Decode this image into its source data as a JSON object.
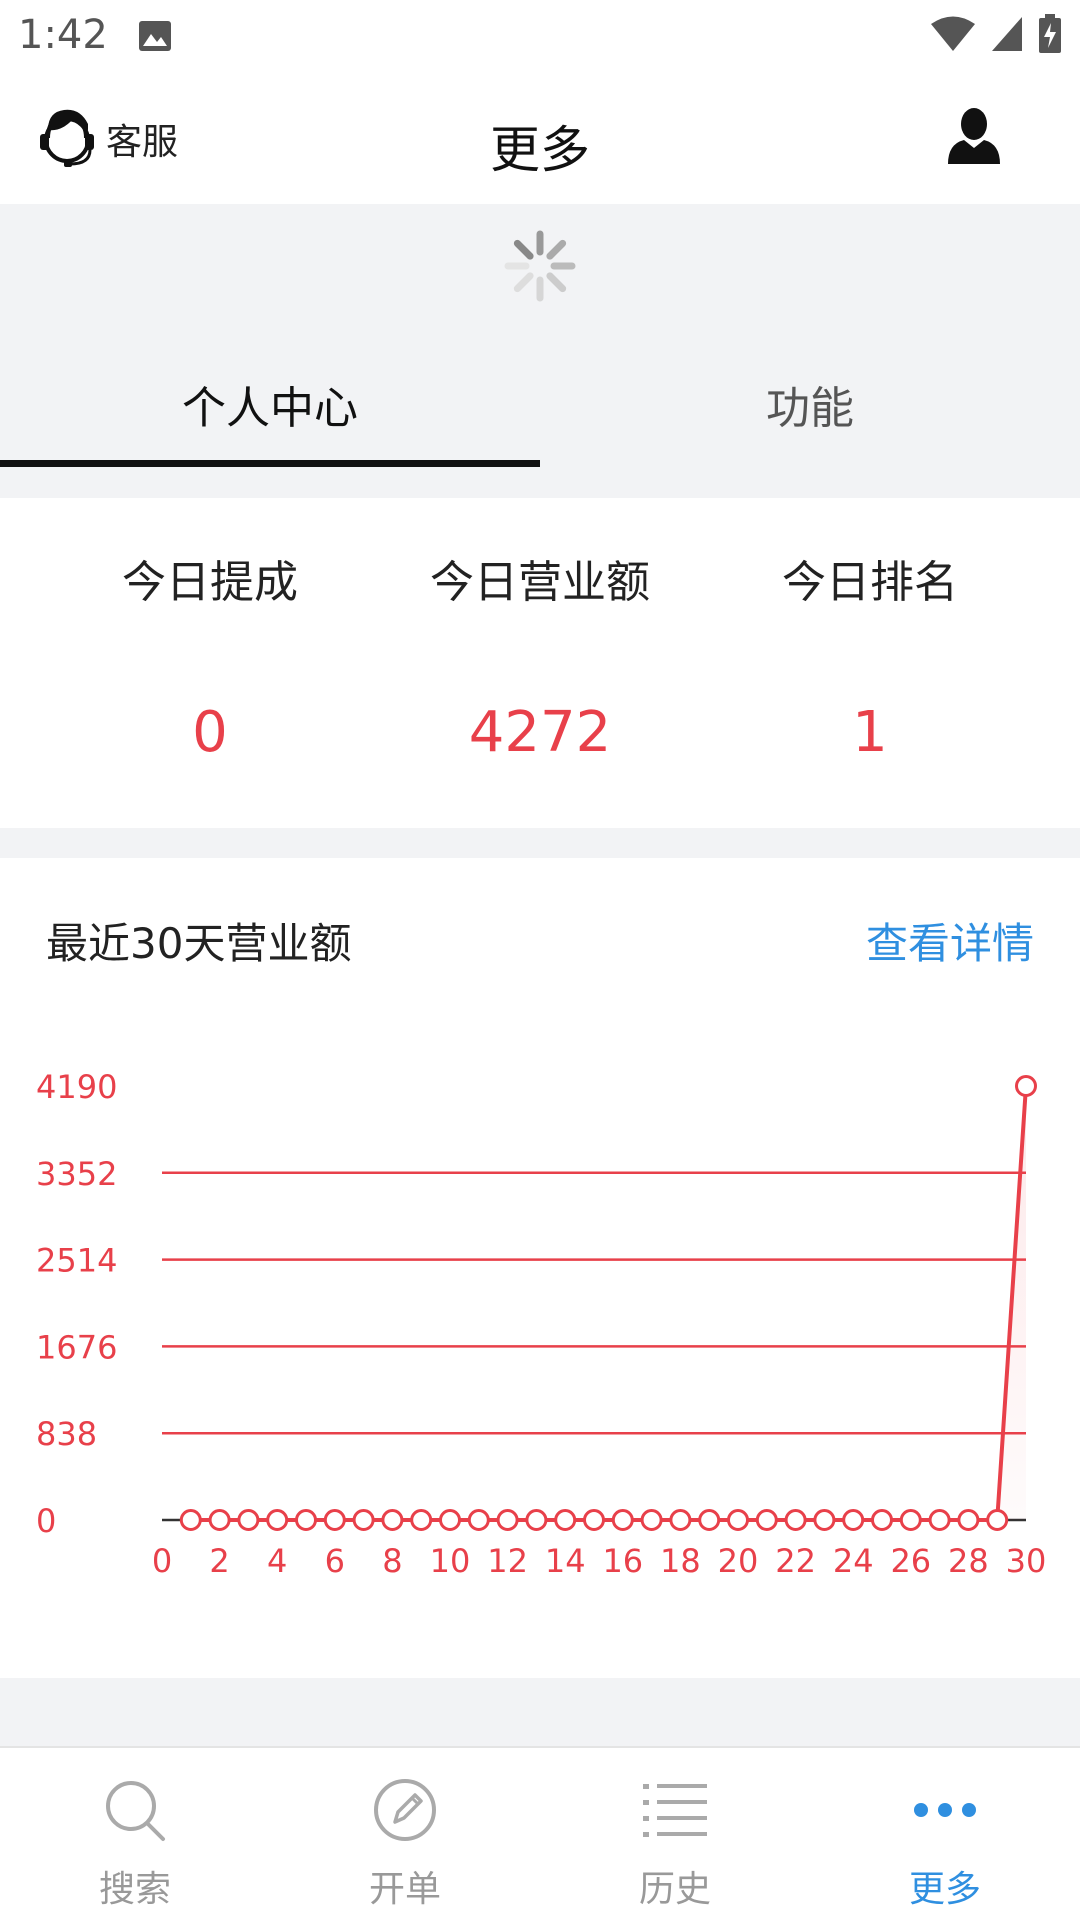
{
  "status_bar": {
    "time": "1:42"
  },
  "header": {
    "customer_service_label": "客服",
    "title": "更多"
  },
  "tabs": [
    {
      "label": "个人中心",
      "active": true
    },
    {
      "label": "功能",
      "active": false
    }
  ],
  "stats": [
    {
      "label": "今日提成",
      "value": "0"
    },
    {
      "label": "今日营业额",
      "value": "4272"
    },
    {
      "label": "今日排名",
      "value": "1"
    }
  ],
  "chart_section": {
    "title": "最近30天营业额",
    "link": "查看详情"
  },
  "chart_data": {
    "type": "line",
    "x": [
      1,
      2,
      3,
      4,
      5,
      6,
      7,
      8,
      9,
      10,
      11,
      12,
      13,
      14,
      15,
      16,
      17,
      18,
      19,
      20,
      21,
      22,
      23,
      24,
      25,
      26,
      27,
      28,
      29,
      30
    ],
    "values": [
      0,
      0,
      0,
      0,
      0,
      0,
      0,
      0,
      0,
      0,
      0,
      0,
      0,
      0,
      0,
      0,
      0,
      0,
      0,
      0,
      0,
      0,
      0,
      0,
      0,
      0,
      0,
      0,
      0,
      4190
    ],
    "xlim": [
      0,
      30
    ],
    "ylim": [
      0,
      4190
    ],
    "x_ticks": [
      "0",
      "2",
      "4",
      "6",
      "8",
      "10",
      "12",
      "14",
      "16",
      "18",
      "20",
      "22",
      "24",
      "26",
      "28",
      "30"
    ],
    "y_ticks": [
      "0",
      "838",
      "1676",
      "2514",
      "3352",
      "4190"
    ],
    "grid": true,
    "color": "#e8404a"
  },
  "bottom_nav": [
    {
      "label": "搜索",
      "icon": "search-icon",
      "active": false
    },
    {
      "label": "开单",
      "icon": "edit-icon",
      "active": false
    },
    {
      "label": "历史",
      "icon": "list-icon",
      "active": false
    },
    {
      "label": "更多",
      "icon": "more-icon",
      "active": true
    }
  ],
  "colors": {
    "accent": "#e8404a",
    "link": "#2f8fe0"
  }
}
